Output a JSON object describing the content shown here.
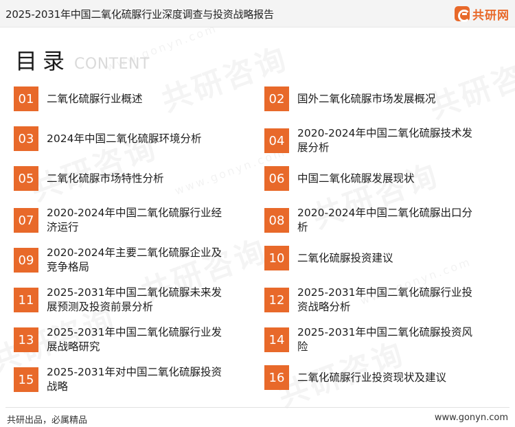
{
  "header": {
    "title": "2025-2031年中国二氧化硫脲行业深度调查与投资战略报告",
    "brand": "共研网",
    "brand_color": "#e8692a",
    "brand_icon": "gonyn-logo-icon"
  },
  "toc": {
    "title": "目录",
    "subtitle": "CONTENT"
  },
  "items": [
    {
      "num": "01",
      "label": "二氧化硫脲行业概述"
    },
    {
      "num": "02",
      "label": "国外二氧化硫脲市场发展概况"
    },
    {
      "num": "03",
      "label": "2024年中国二氧化硫脲环境分析"
    },
    {
      "num": "04",
      "label": "2020-2024年中国二氧化硫脲技术发展分析"
    },
    {
      "num": "05",
      "label": "二氧化硫脲市场特性分析"
    },
    {
      "num": "06",
      "label": "中国二氧化硫脲发展现状"
    },
    {
      "num": "07",
      "label": "2020-2024年中国二氧化硫脲行业经济运行"
    },
    {
      "num": "08",
      "label": "2020-2024年中国二氧化硫脲出口分析"
    },
    {
      "num": "09",
      "label": "2020-2024年主要二氧化硫脲企业及竞争格局"
    },
    {
      "num": "10",
      "label": "二氧化硫脲投资建议"
    },
    {
      "num": "11",
      "label": "2025-2031年中国二氧化硫脲未来发展预测及投资前景分析"
    },
    {
      "num": "12",
      "label": "2025-2031年中国二氧化硫脲行业投资战略分析"
    },
    {
      "num": "13",
      "label": "2025-2031年中国二氧化硫脲行业发展战略研究"
    },
    {
      "num": "14",
      "label": "2025-2031年中国二氧化硫脲投资风险"
    },
    {
      "num": "15",
      "label": "2025-2031年对中国二氧化硫脲投资战略"
    },
    {
      "num": "16",
      "label": "二氧化硫脲行业投资现状及建议"
    }
  ],
  "footer": {
    "slogan": "共研出品，必属精品",
    "url": "www.gonyn.com"
  },
  "watermark": {
    "text": "共研咨询",
    "url": "www.gonyn.com"
  }
}
